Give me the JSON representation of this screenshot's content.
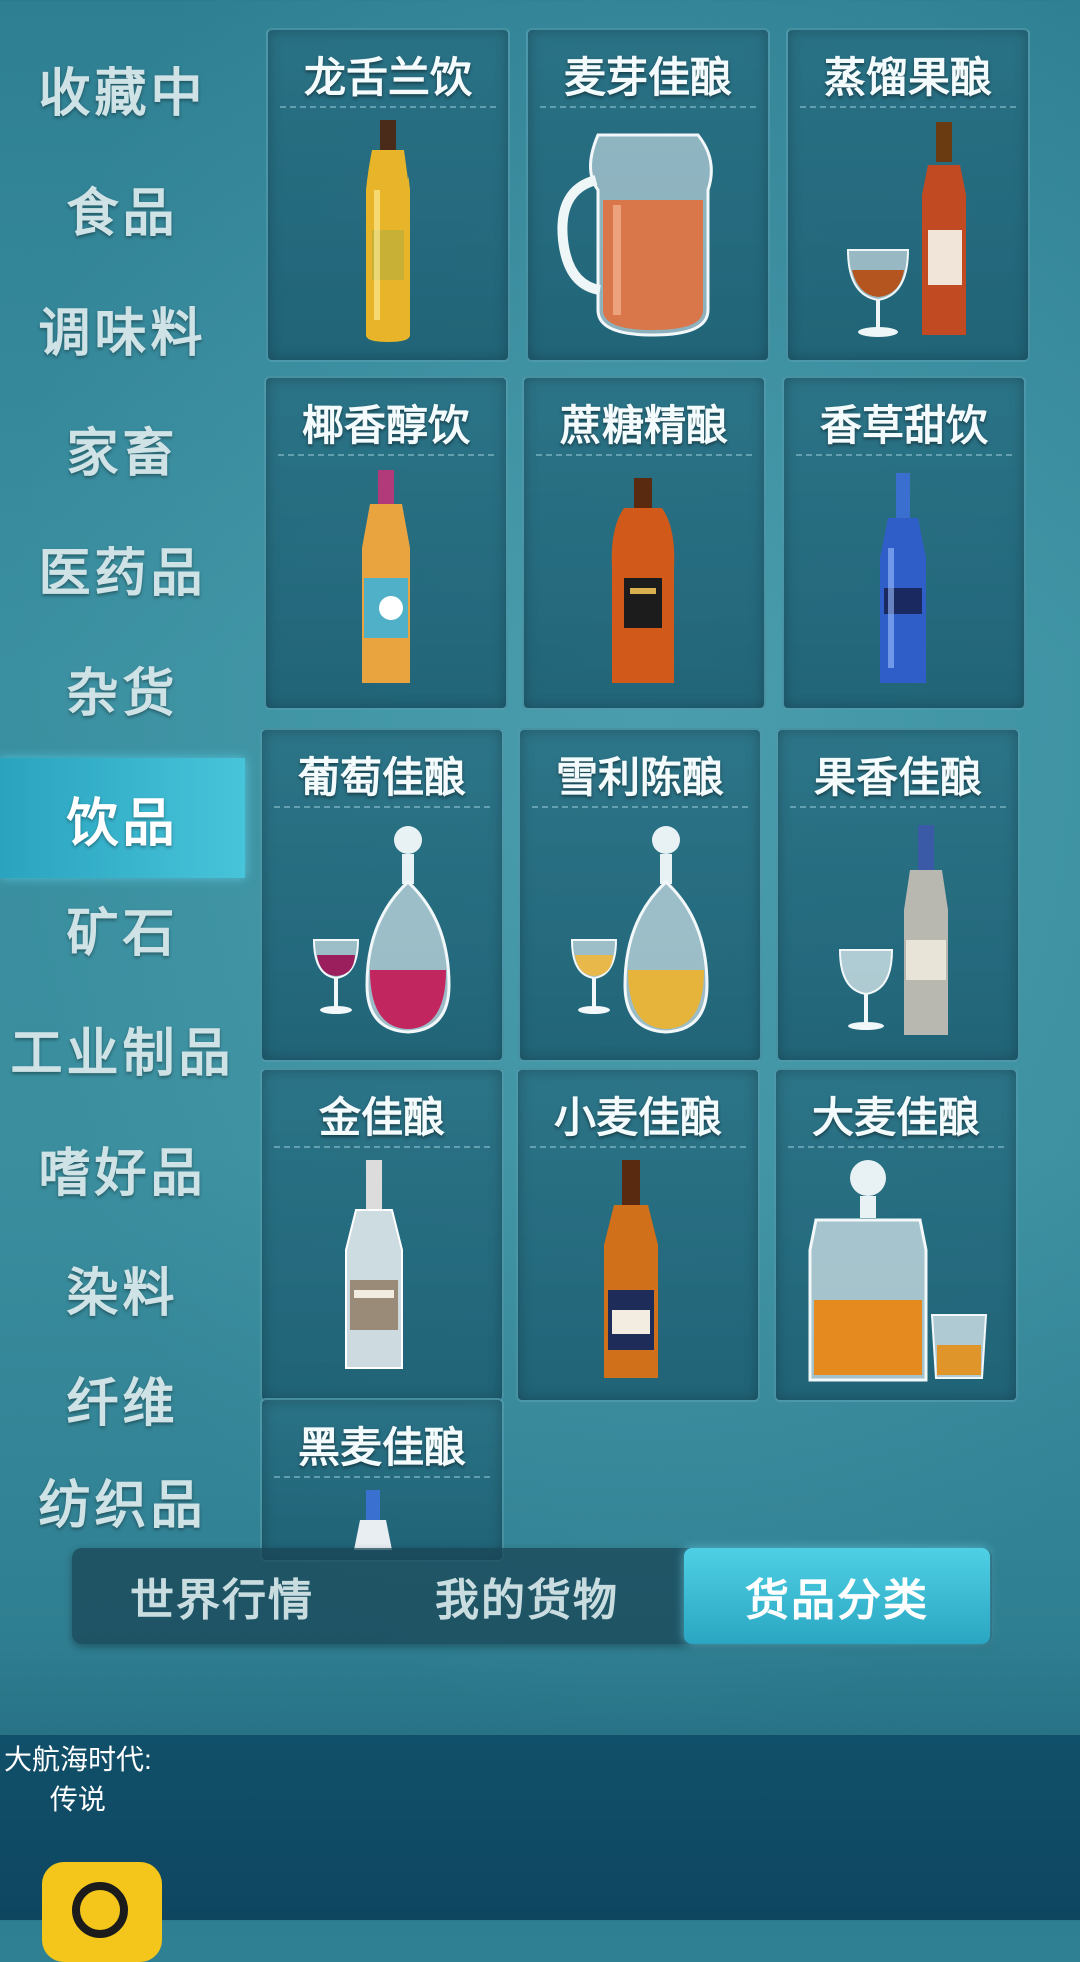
{
  "sidebar": {
    "items": [
      {
        "label": "收藏中"
      },
      {
        "label": "食品"
      },
      {
        "label": "调味料"
      },
      {
        "label": "家畜"
      },
      {
        "label": "医药品"
      },
      {
        "label": "杂货"
      },
      {
        "label": "饮品",
        "active": true
      },
      {
        "label": "矿石"
      },
      {
        "label": "工业制品"
      },
      {
        "label": "嗜好品"
      },
      {
        "label": "染料"
      },
      {
        "label": "纤维"
      },
      {
        "label": "纺织品"
      }
    ]
  },
  "goods": {
    "items": [
      {
        "name": "龙舌兰饮",
        "icon": "yellow-bottle-icon"
      },
      {
        "name": "麦芽佳酿",
        "icon": "pitcher-icon"
      },
      {
        "name": "蒸馏果酿",
        "icon": "brandy-bottle-glass-icon"
      },
      {
        "name": "椰香醇饮",
        "icon": "coconut-bottle-icon"
      },
      {
        "name": "蔗糖精酿",
        "icon": "rum-bottle-icon"
      },
      {
        "name": "香草甜饮",
        "icon": "blue-bottle-icon"
      },
      {
        "name": "葡萄佳酿",
        "icon": "wine-decanter-icon"
      },
      {
        "name": "雪利陈酿",
        "icon": "sherry-decanter-icon"
      },
      {
        "name": "果香佳酿",
        "icon": "silver-bottle-glass-icon"
      },
      {
        "name": "金佳酿",
        "icon": "gin-bottle-icon"
      },
      {
        "name": "小麦佳酿",
        "icon": "whisky-bottle-icon"
      },
      {
        "name": "大麦佳酿",
        "icon": "whisky-decanter-icon"
      },
      {
        "name": "黑麦佳酿",
        "icon": "rye-bottle-icon"
      }
    ]
  },
  "tabs": [
    {
      "label": "世界行情"
    },
    {
      "label": "我的货物"
    },
    {
      "label": "货品分类",
      "active": true
    }
  ],
  "bottom": {
    "app_name_line1": "大航海时代:",
    "app_name_line2": "传说"
  }
}
